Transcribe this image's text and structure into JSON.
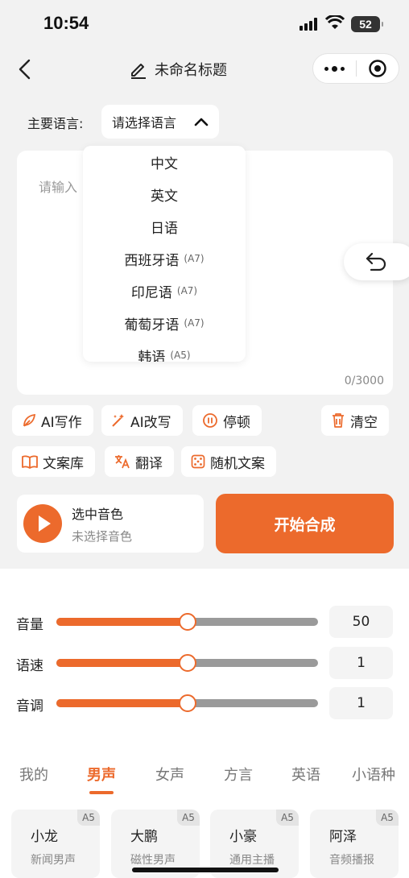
{
  "status_bar": {
    "time": "10:54",
    "battery": "52"
  },
  "nav": {
    "title": "未命名标题"
  },
  "language": {
    "label": "主要语言:",
    "selected": "请选择语言"
  },
  "dropdown": {
    "options": [
      {
        "label": "中文",
        "tag": ""
      },
      {
        "label": "英文",
        "tag": ""
      },
      {
        "label": "日语",
        "tag": ""
      },
      {
        "label": "西班牙语",
        "tag": "(A7)"
      },
      {
        "label": "印尼语",
        "tag": "(A7)"
      },
      {
        "label": "葡萄牙语",
        "tag": "(A7)"
      },
      {
        "label": "韩语",
        "tag": "(A5)"
      }
    ]
  },
  "editor": {
    "placeholder": "请输入",
    "counter": "0/3000"
  },
  "toolbar": {
    "ai_write": "AI写作",
    "ai_rewrite": "AI改写",
    "pause": "停顿",
    "clear": "清空",
    "library": "文案库",
    "translate": "翻译",
    "random": "随机文案"
  },
  "voice": {
    "title": "选中音色",
    "subtitle": "未选择音色"
  },
  "start_button": "开始合成",
  "sliders": [
    {
      "label": "音量",
      "value": "50",
      "fraction": 0.5
    },
    {
      "label": "语速",
      "value": "1",
      "fraction": 0.5
    },
    {
      "label": "音调",
      "value": "1",
      "fraction": 0.5
    }
  ],
  "tabs": [
    "我的",
    "男声",
    "女声",
    "方言",
    "英语",
    "小语种"
  ],
  "active_tab": "男声",
  "voice_cards": [
    {
      "name": "小龙",
      "desc": "新闻男声",
      "badge": "A5"
    },
    {
      "name": "大鹏",
      "desc": "磁性男声",
      "badge": "A5"
    },
    {
      "name": "小豪",
      "desc": "通用主播",
      "badge": "A5"
    },
    {
      "name": "阿泽",
      "desc": "音频播报",
      "badge": "A5"
    }
  ],
  "colors": {
    "accent": "#ec6a2c",
    "background": "#f2f2f2"
  }
}
